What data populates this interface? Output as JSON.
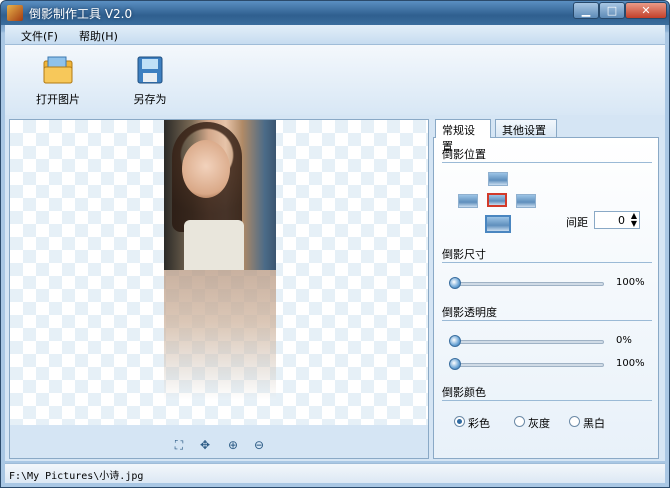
{
  "window": {
    "title": "倒影制作工具 V2.0"
  },
  "menu": {
    "items": [
      "文件(F)",
      "帮助(H)"
    ]
  },
  "toolbar": {
    "open_label": "打开图片",
    "save_label": "另存为"
  },
  "tabs": {
    "active": "常规设置",
    "other": "其他设置"
  },
  "settings": {
    "position_title": "倒影位置",
    "spacing_label": "间距",
    "spacing_value": "0",
    "size_title": "倒影尺寸",
    "size_value": "100%",
    "opacity_title": "倒影透明度",
    "opacity_start": "0%",
    "opacity_end": "100%",
    "color_title": "倒影颜色",
    "color_options": [
      "彩色",
      "灰度",
      "黑白"
    ],
    "color_selected": "彩色"
  },
  "status": {
    "path": "F:\\My Pictures\\小诗.jpg"
  }
}
